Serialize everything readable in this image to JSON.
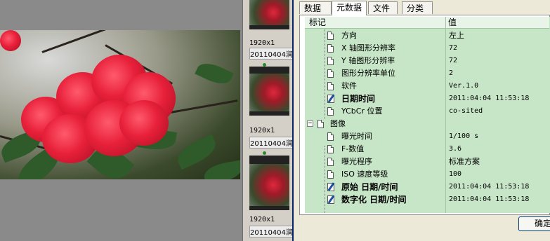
{
  "filmstrip": {
    "thumbnails": [
      {
        "resolution": "1920x1",
        "name": "20110404润"
      },
      {
        "resolution": "1920x1",
        "name": "20110404润"
      },
      {
        "resolution": "1920x1",
        "name": "20110404润"
      }
    ]
  },
  "dialog": {
    "tabs": [
      {
        "label": "数据库",
        "active": false
      },
      {
        "label": "元数据",
        "active": true
      },
      {
        "label": "文件",
        "active": false
      },
      {
        "label": "分类",
        "active": false
      }
    ],
    "columns": {
      "tag": "标记",
      "value": "值"
    },
    "rows": [
      {
        "label": "方向",
        "value": "左上",
        "icon": "doc-icon"
      },
      {
        "label": "X 轴图形分辨率",
        "value": "72",
        "icon": "doc-icon"
      },
      {
        "label": "Y 轴图形分辨率",
        "value": "72",
        "icon": "doc-icon"
      },
      {
        "label": "图形分辨率单位",
        "value": "2",
        "icon": "doc-icon"
      },
      {
        "label": "软件",
        "value": "Ver.1.0",
        "icon": "doc-icon"
      },
      {
        "label": "日期时间",
        "value": "2011:04:04 11:53:18",
        "icon": "edit-icon"
      },
      {
        "label": "YCbCr 位置",
        "value": "co-sited",
        "icon": "doc-icon"
      },
      {
        "label": "图像",
        "value": "",
        "icon": "doc-icon"
      },
      {
        "label": "曝光时间",
        "value": "1/100 s",
        "icon": "doc-icon"
      },
      {
        "label": "F-数值",
        "value": "3.6",
        "icon": "doc-icon"
      },
      {
        "label": "曝光程序",
        "value": "标准方案",
        "icon": "doc-icon"
      },
      {
        "label": "ISO 速度等级",
        "value": "100",
        "icon": "doc-icon"
      },
      {
        "label": "原始 日期/时间",
        "value": "2011:04:04 11:53:18",
        "icon": "edit-icon"
      },
      {
        "label": "数字化 日期/时间",
        "value": "2011:04:04 11:53:18",
        "icon": "edit-icon"
      }
    ],
    "group_expander": "−",
    "ok_label": "确定"
  },
  "colors": {
    "grid_background": "#c7e6c7",
    "dialog_border": "#0a246a",
    "dialog_face": "#ece9d8"
  }
}
